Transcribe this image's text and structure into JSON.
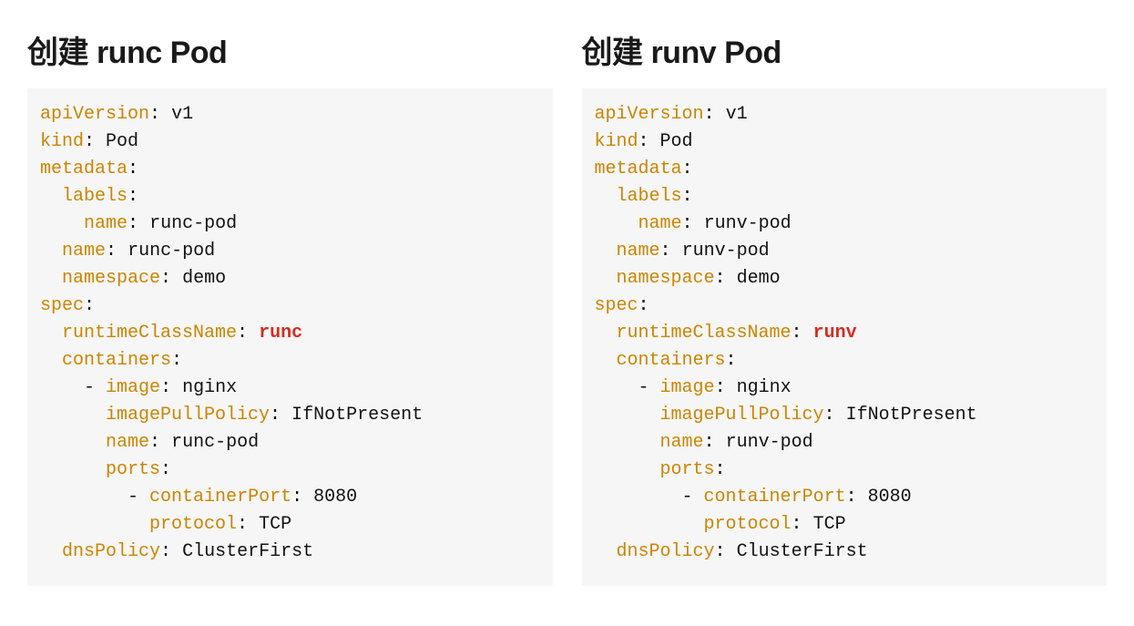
{
  "columns": [
    {
      "heading": "创建 runc Pod",
      "yaml": {
        "apiVersion": "v1",
        "kind": "Pod",
        "metadata": {
          "labels": {
            "name": "runc-pod"
          },
          "name": "runc-pod",
          "namespace": "demo"
        },
        "spec": {
          "runtimeClassName": "runc",
          "containers": [
            {
              "image": "nginx",
              "imagePullPolicy": "IfNotPresent",
              "name": "runc-pod",
              "ports": [
                {
                  "containerPort": 8080,
                  "protocol": "TCP"
                }
              ]
            }
          ],
          "dnsPolicy": "ClusterFirst"
        }
      },
      "keys": {
        "apiVersion": "apiVersion",
        "kind": "kind",
        "metadata": "metadata",
        "labels": "labels",
        "name": "name",
        "namespace": "namespace",
        "spec": "spec",
        "runtimeClassName": "runtimeClassName",
        "containers": "containers",
        "image": "image",
        "imagePullPolicy": "imagePullPolicy",
        "ports": "ports",
        "containerPort": "containerPort",
        "protocol": "protocol",
        "dnsPolicy": "dnsPolicy"
      }
    },
    {
      "heading": "创建 runv Pod",
      "yaml": {
        "apiVersion": "v1",
        "kind": "Pod",
        "metadata": {
          "labels": {
            "name": "runv-pod"
          },
          "name": "runv-pod",
          "namespace": "demo"
        },
        "spec": {
          "runtimeClassName": "runv",
          "containers": [
            {
              "image": "nginx",
              "imagePullPolicy": "IfNotPresent",
              "name": "runv-pod",
              "ports": [
                {
                  "containerPort": 8080,
                  "protocol": "TCP"
                }
              ]
            }
          ],
          "dnsPolicy": "ClusterFirst"
        }
      },
      "keys": {
        "apiVersion": "apiVersion",
        "kind": "kind",
        "metadata": "metadata",
        "labels": "labels",
        "name": "name",
        "namespace": "namespace",
        "spec": "spec",
        "runtimeClassName": "runtimeClassName",
        "containers": "containers",
        "image": "image",
        "imagePullPolicy": "imagePullPolicy",
        "ports": "ports",
        "containerPort": "containerPort",
        "protocol": "protocol",
        "dnsPolicy": "dnsPolicy"
      }
    }
  ]
}
